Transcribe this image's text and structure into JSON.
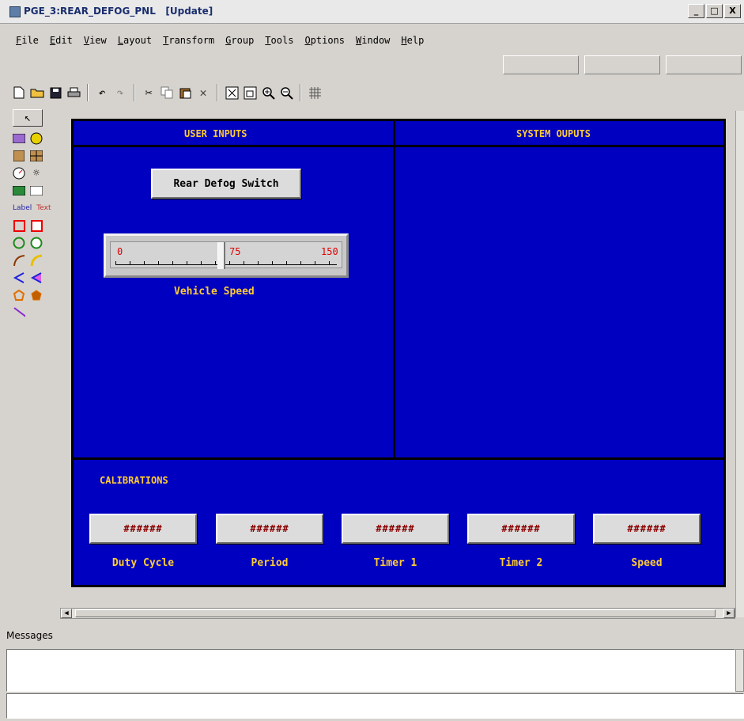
{
  "window": {
    "title": "PGE_3:REAR_DEFOG_PNL   [Update]",
    "controls": [
      "_",
      "□",
      "X"
    ]
  },
  "menu": [
    "File",
    "Edit",
    "View",
    "Layout",
    "Transform",
    "Group",
    "Tools",
    "Options",
    "Window",
    "Help"
  ],
  "toolbar": {
    "icons": [
      "new-file-icon",
      "open-folder-icon",
      "save-icon",
      "print-icon",
      "undo-icon",
      "redo-icon",
      "cut-icon",
      "copy-icon",
      "paste-icon",
      "delete-icon",
      "fit-view-icon",
      "zoom-box-icon",
      "zoom-in-icon",
      "zoom-out-icon",
      "grid-icon"
    ]
  },
  "palette": {
    "label_tool": "Label",
    "text_tool": "Text"
  },
  "panel": {
    "user_inputs_header": "USER INPUTS",
    "system_outputs_header": "SYSTEM OUPUTS",
    "rear_defog_button": "Rear Defog Switch",
    "slider": {
      "label": "Vehicle Speed",
      "min": "0",
      "mid": "75",
      "max": "150",
      "value": 75
    },
    "calibrations_header": "CALIBRATIONS",
    "calibrations": [
      {
        "value": "######",
        "label": "Duty Cycle"
      },
      {
        "value": "######",
        "label": "Period"
      },
      {
        "value": "######",
        "label": "Timer 1"
      },
      {
        "value": "######",
        "label": "Timer 2"
      },
      {
        "value": "######",
        "label": "Speed"
      }
    ]
  },
  "messages": {
    "label": "Messages"
  }
}
